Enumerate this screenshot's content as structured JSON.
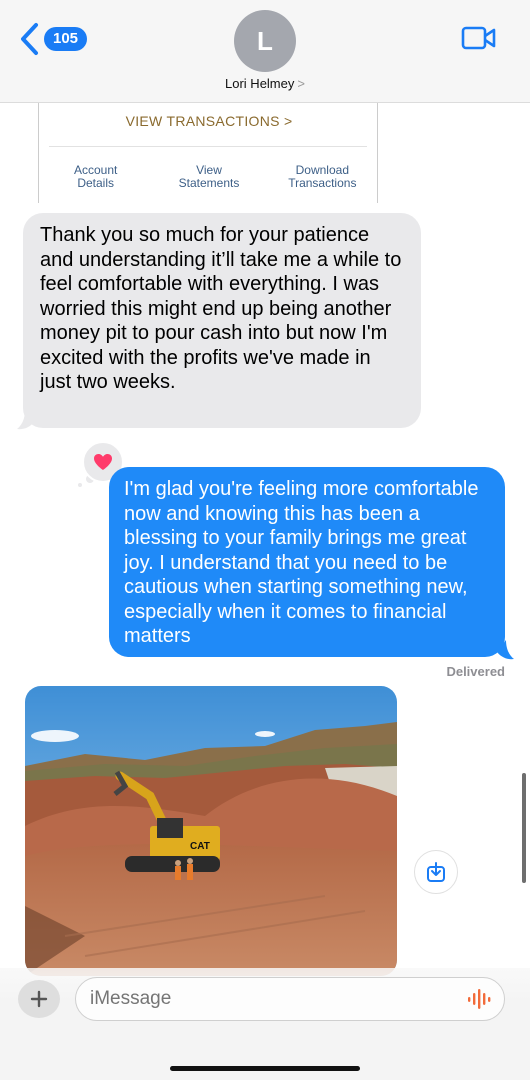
{
  "header": {
    "back_count": "105",
    "avatar_initial": "L",
    "contact_name": "Lori Helmey",
    "name_chevron": ">"
  },
  "screenshot_card": {
    "view_transactions": "VIEW TRANSACTIONS  >",
    "links": [
      {
        "line1": "Account",
        "line2": "Details"
      },
      {
        "line1": "View",
        "line2": "Statements"
      },
      {
        "line1": "Download",
        "line2": "Transactions"
      }
    ]
  },
  "messages": {
    "received_text": "Thank you so much for your patience and understanding it’ll take me a while to feel comfortable with everything. I was worried this might end up being another money pit to pour cash into but now I'm excited with the profits we've made in just two weeks.",
    "sent_text": "I'm glad you're feeling more comfortable now and knowing this has been a blessing to your family brings me great joy. I understand that you need to be cautious when starting something new, especially when it comes to financial matters",
    "status": "Delivered",
    "tapback": "heart",
    "photo_machine_label": "CAT"
  },
  "input": {
    "placeholder": "iMessage"
  },
  "colors": {
    "accent": "#1a7cf5",
    "sent_bubble": "#1f8af8",
    "received_bubble": "#e9e9eb",
    "tapback_heart": "#ff3b6b",
    "mic_accent": "#f26b3a"
  }
}
